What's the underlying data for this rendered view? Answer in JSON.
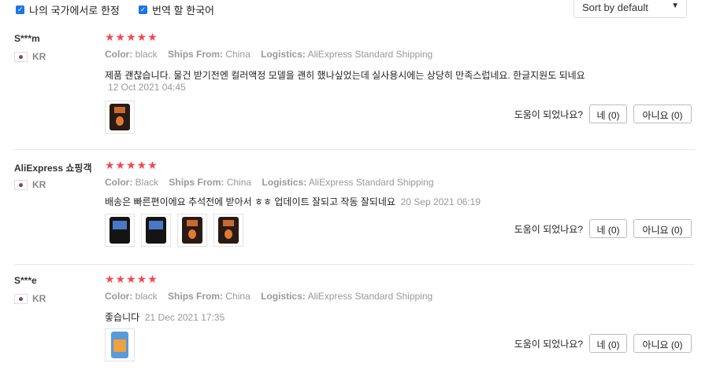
{
  "filters": {
    "local_only_label": "나의 국가에서로 한정",
    "translate_label": "번역 할 한국어",
    "sort_value": "Sort by default"
  },
  "helpful_prompt": "도움이 되었나요?",
  "reviews": [
    {
      "name": "S***m",
      "country": "KR",
      "stars": "★★★★★",
      "attrs": {
        "color_label": "Color:",
        "color": "black",
        "ships_label": "Ships From:",
        "ships": "China",
        "logistics_label": "Logistics:",
        "logistics": "AliExpress Standard Shipping"
      },
      "text": "제품 괜찮습니다. 물건 받기전엔 컬러액정 모델을 괜히 했나싶었는데 실사용시에는 상당히 만족스럽네요. 한글지원도 되네요",
      "date": "12 Oct 2021 04:45",
      "yes_label": "네 (0)",
      "no_label": "아니요 (0)"
    },
    {
      "name": "AliExpress 쇼핑객",
      "country": "KR",
      "stars": "★★★★★",
      "attrs": {
        "color_label": "Color:",
        "color": "Black",
        "ships_label": "Ships From:",
        "ships": "China",
        "logistics_label": "Logistics:",
        "logistics": "AliExpress Standard Shipping"
      },
      "text": "배송은 빠른편이에요 추석전에 받아서 ㅎㅎ 업데이트 잘되고 작동 잘되네요",
      "date": "20 Sep 2021 06:19",
      "yes_label": "네 (0)",
      "no_label": "아니요 (0)"
    },
    {
      "name": "S***e",
      "country": "KR",
      "stars": "★★★★★",
      "attrs": {
        "color_label": "Color:",
        "color": "black",
        "ships_label": "Ships From:",
        "ships": "China",
        "logistics_label": "Logistics:",
        "logistics": "AliExpress Standard Shipping"
      },
      "text": "좋습니다",
      "date": "21 Dec 2021 17:35",
      "yes_label": "네 (0)",
      "no_label": "아니요 (0)"
    }
  ]
}
